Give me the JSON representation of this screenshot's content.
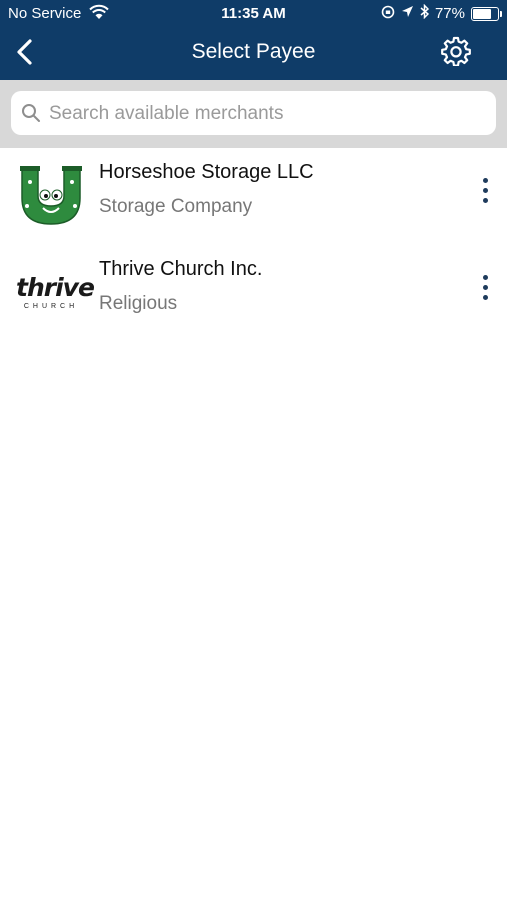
{
  "status_bar": {
    "carrier": "No Service",
    "time": "11:35 AM",
    "battery_percent": "77%",
    "battery_level": 0.77,
    "icons": [
      "wifi-icon",
      "lock-rotation-icon",
      "location-arrow-icon",
      "bluetooth-icon",
      "battery-icon"
    ]
  },
  "nav": {
    "title": "Select Payee",
    "back_icon": "chevron-left-icon",
    "settings_icon": "gear-icon"
  },
  "search": {
    "placeholder": "Search available merchants",
    "value": "",
    "icon": "magnifier-icon"
  },
  "payees": [
    {
      "name": "Horseshoe Storage LLC",
      "category": "Storage Company",
      "logo": "horseshoe-logo"
    },
    {
      "name": "Thrive Church Inc.",
      "category": "Religious",
      "logo": "thrive-logo",
      "logo_text": "thrive",
      "logo_subtext": "CHURCH"
    }
  ],
  "colors": {
    "header": "#0f3c68",
    "search_band": "#d8d8d8",
    "horseshoe_green": "#2e8b3e",
    "menu_dots": "#1f3b5c"
  }
}
